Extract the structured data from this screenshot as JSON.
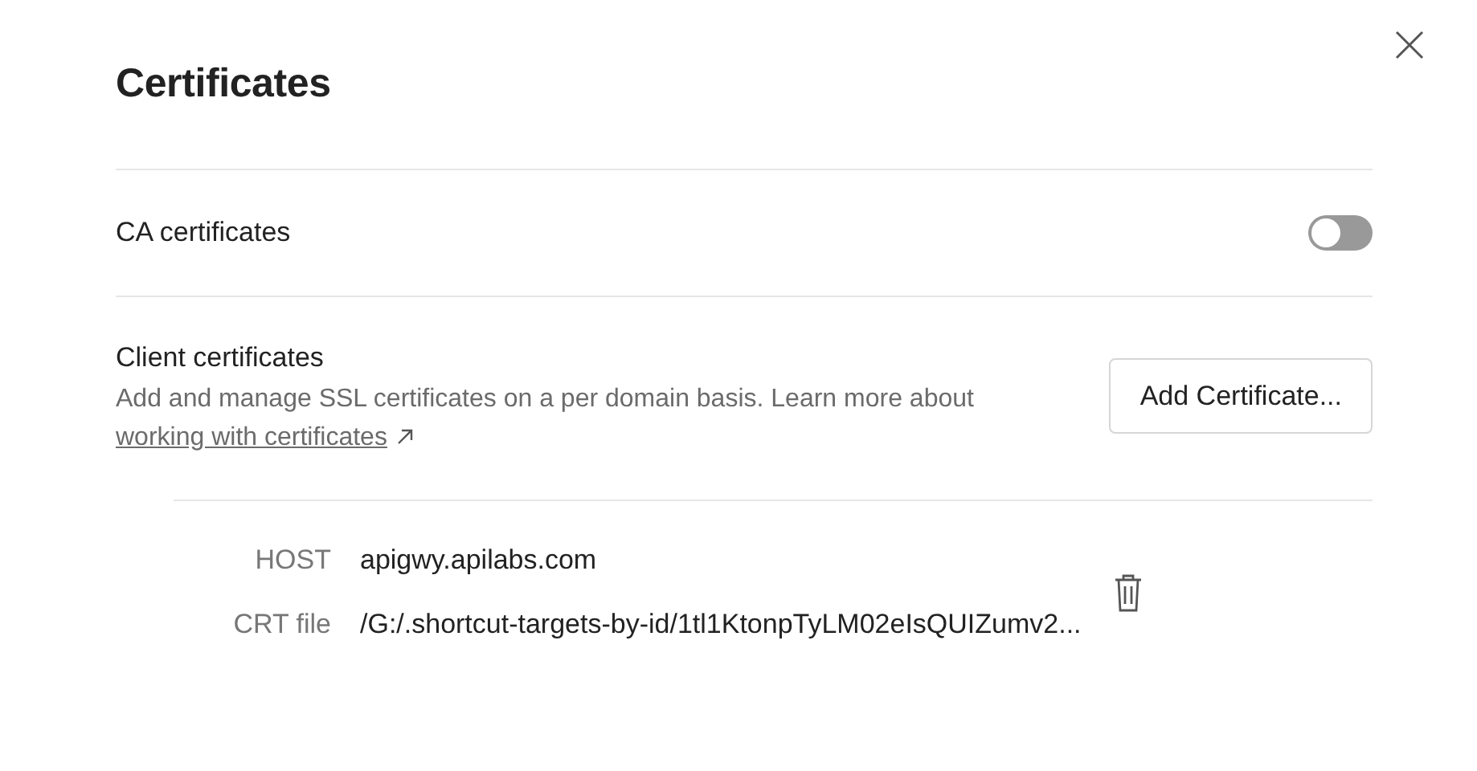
{
  "title": "Certificates",
  "ca": {
    "label": "CA certificates",
    "on": false
  },
  "client": {
    "label": "Client certificates",
    "description": "Add and manage SSL certificates on a per domain basis. Learn more about",
    "link": "working with certificates",
    "button": "Add Certificate..."
  },
  "certificates": [
    {
      "fields": [
        {
          "label": "HOST",
          "value": "apigwy.apilabs.com"
        },
        {
          "label": "CRT file",
          "value": "/G:/.shortcut-targets-by-id/1tl1KtonpTyLM02eIsQUIZumv2..."
        }
      ]
    }
  ]
}
